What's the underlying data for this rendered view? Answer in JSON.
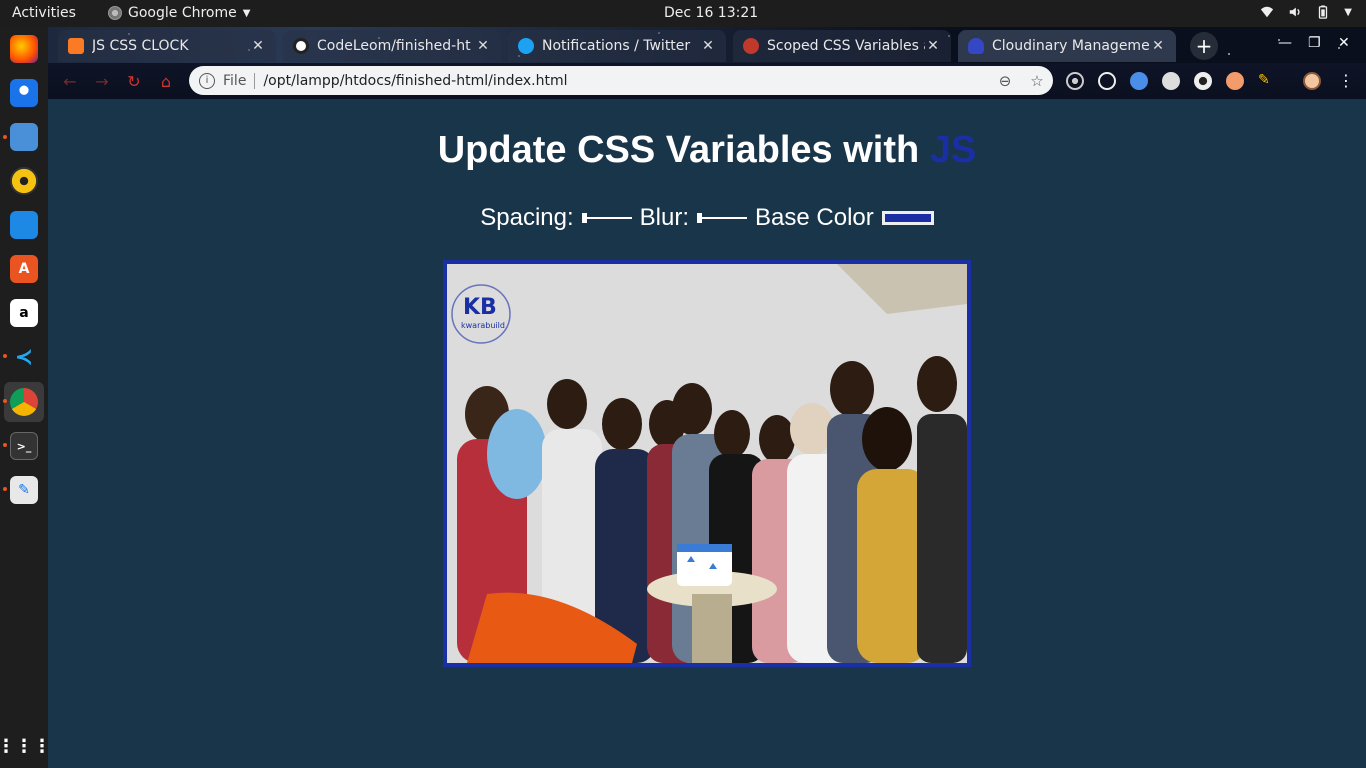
{
  "topbar": {
    "activities": "Activities",
    "app_name": "Google Chrome",
    "clock": "Dec 16  13:21"
  },
  "dock": {
    "items": [
      "firefox-icon",
      "thunderbird-icon",
      "files-icon",
      "rhythmbox-icon",
      "writer-icon",
      "software-icon",
      "amazon-icon",
      "vscode-icon",
      "chrome-icon",
      "terminal-icon",
      "text-editor-icon",
      "show-apps-icon"
    ]
  },
  "tabs": [
    {
      "title": "JS CSS CLOCK",
      "favicon": "xampp-icon",
      "color": "#fb7a24"
    },
    {
      "title": "CodeLeom/finished-ht",
      "favicon": "github-icon",
      "color": "#222222"
    },
    {
      "title": "Notifications / Twitter",
      "favicon": "twitter-icon",
      "color": "#1da1f2"
    },
    {
      "title": "Scoped CSS Variables a",
      "favicon": "red-circle-icon",
      "color": "#c0392b"
    },
    {
      "title": "Cloudinary Managemen",
      "favicon": "cloudinary-icon",
      "color": "#3448c5"
    }
  ],
  "omnibox": {
    "security_label": "File",
    "url": "/opt/lampp/htdocs/finished-html/index.html"
  },
  "page": {
    "heading_main": "Update CSS Variables with",
    "heading_highlight": "JS",
    "spacing_label": "Spacing:",
    "blur_label": "Blur:",
    "base_color_label": "Base Color",
    "base_color": "#1a2fa3",
    "background_color": "#193549",
    "photo_logo_text": "kwarabuild"
  }
}
